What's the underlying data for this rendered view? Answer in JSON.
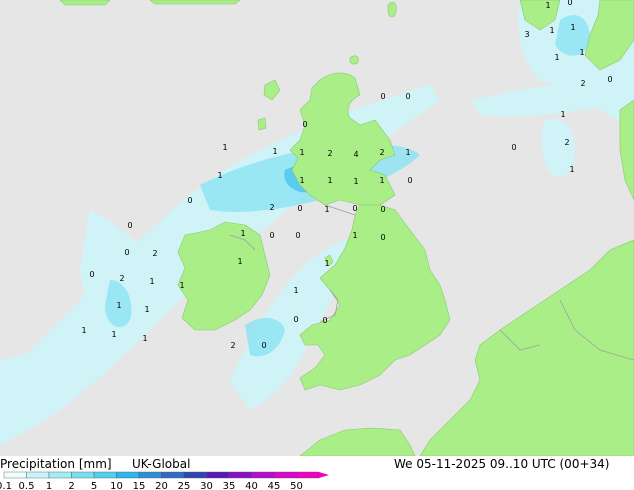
{
  "footer": {
    "title": "Precipitation [mm]",
    "model": "UK-Global",
    "valid_time": "We 05-11-2025 09..10 UTC (00+34)"
  },
  "legend": {
    "ticks": [
      "0.1",
      "0.5",
      "1",
      "2",
      "5",
      "10",
      "15",
      "20",
      "25",
      "30",
      "35",
      "40",
      "45",
      "50"
    ],
    "colors": [
      "#eefeff",
      "#c8f5fb",
      "#a0ecf7",
      "#78dff3",
      "#50cfee",
      "#2fb6e8",
      "#2f8fd6",
      "#2f6ac4",
      "#2e45b2",
      "#5a18b8",
      "#8a10c8",
      "#b80cd0",
      "#d808cc",
      "#f000c0"
    ]
  },
  "colors": {
    "sea": "#e6e6e6",
    "land": "#aaee88",
    "border": "#a0a0a0"
  },
  "map_labels": [
    "1",
    "0",
    "1",
    "1",
    "3",
    "1",
    "1",
    "2",
    "0",
    "0",
    "0",
    "1",
    "0",
    "2",
    "1",
    "1",
    "0",
    "1",
    "1",
    "2",
    "4",
    "2",
    "1",
    "1",
    "1",
    "1",
    "1",
    "0",
    "1",
    "0",
    "2",
    "0",
    "1",
    "0",
    "0",
    "1",
    "0",
    "0",
    "1",
    "0",
    "0",
    "0",
    "2",
    "1",
    "1",
    "0",
    "2",
    "1",
    "1",
    "1",
    "1",
    "1",
    "0",
    "0",
    "1",
    "1",
    "1",
    "2",
    "0"
  ]
}
